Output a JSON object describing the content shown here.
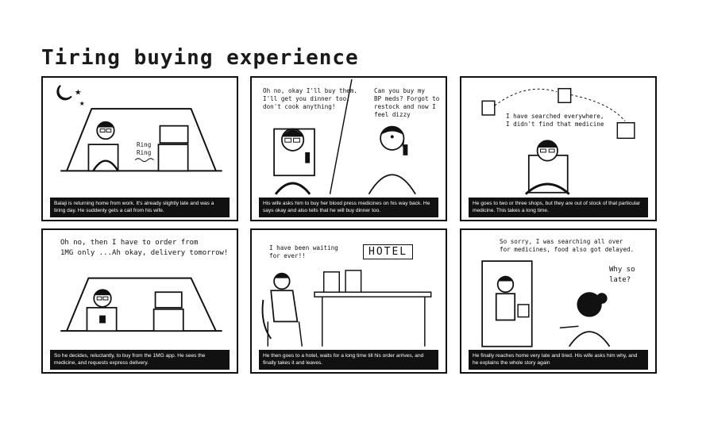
{
  "title": "Tiring buying experience",
  "panels": [
    {
      "caption": "Balaji is returning home from work. It's already slightly late and was a tiring day. He suddenly gets a call from his wife.",
      "sfx": "Ring\nRing"
    },
    {
      "caption": "His wife asks him to buy her blood press medicines on his way back. He says okay and also tells that he will buy dinner too.",
      "speech_him": "Oh no, okay I'll buy them.\nI'll get you dinner too,\ndon't cook anything!",
      "speech_her": "Can you buy my\nBP meds? Forgot to\nrestock and now I\nfeel dizzy"
    },
    {
      "caption": "He goes to two or three shops, but they are out of stock of that particular medicine. This takes a long time.",
      "thought": "I have searched everywhere,\nI didn't find that medicine"
    },
    {
      "caption": "So he decides, reluctantly, to buy from the 1MG app. He sees the medicine, and requests express delivery.",
      "thought": "Oh no, then I have to order from\n1MG only ...Ah okay, delivery tomorrow!"
    },
    {
      "caption": "He then goes to a hotel, waits for a long time till his order arrives, and finally takes it and leaves.",
      "thought": "I have been waiting\nfor ever!!",
      "sign": "HOTEL"
    },
    {
      "caption": "He finally reaches home very late and tired. His wife asks him why, and he explains the whole story again",
      "speech_him": "So sorry, I was searching all over\nfor medicines, food also got delayed.",
      "speech_her": "Why so\nlate?"
    }
  ]
}
